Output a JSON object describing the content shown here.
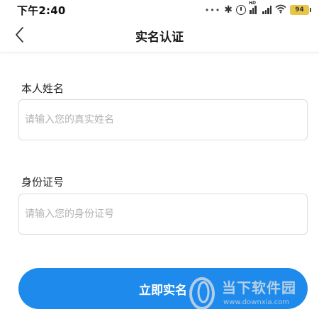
{
  "status_bar": {
    "time": "下午2:40",
    "dots": "•••",
    "network_hd": "HD",
    "battery": "94"
  },
  "nav": {
    "title": "实名认证"
  },
  "form": {
    "name_label": "本人姓名",
    "name_placeholder": "请输入您的真实姓名",
    "name_value": "",
    "id_label": "身份证号",
    "id_placeholder": "请输入您的身份证号",
    "id_value": ""
  },
  "submit": {
    "label": "立即实名"
  },
  "watermark": {
    "site_name": "当下软件园",
    "url": "www.downxia.com"
  },
  "colors": {
    "accent": "#1e8bec",
    "battery": "#e8c547",
    "input_border": "#dcdcdc",
    "placeholder": "#b3b3b3"
  }
}
